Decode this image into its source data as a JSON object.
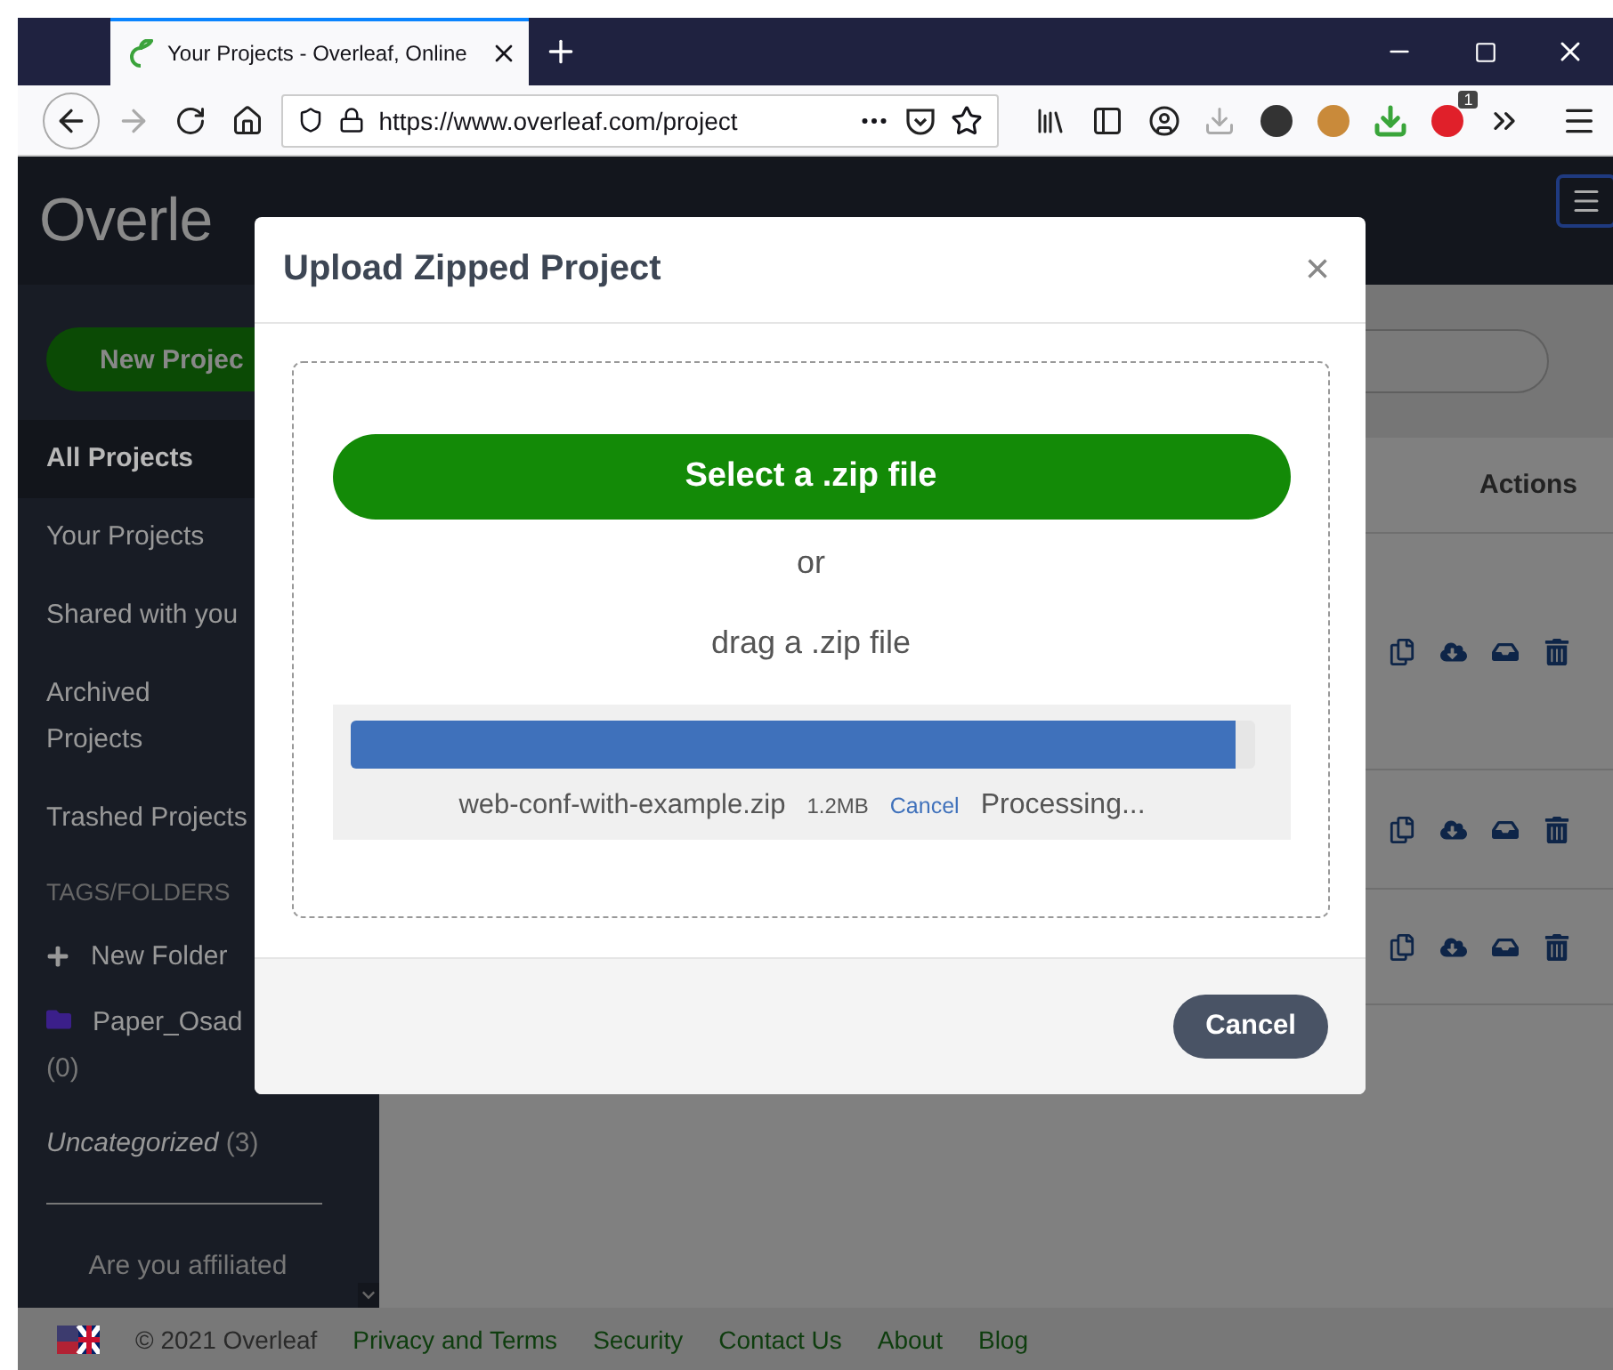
{
  "browser": {
    "tab": {
      "title": "Your Projects - Overleaf, Online",
      "selected": true
    },
    "url": "https://www.overleaf.com/project",
    "extension_badge": "1"
  },
  "header": {
    "logo": "Overle"
  },
  "sidebar": {
    "new_project": "New Projec",
    "items": [
      {
        "label": "All Projects",
        "selected": true
      },
      {
        "label": "Your Projects",
        "selected": false
      },
      {
        "label": "Shared with you",
        "selected": false
      },
      {
        "label": "Archived Projects",
        "selected": false
      },
      {
        "label": "Trashed Projects",
        "selected": false
      }
    ],
    "tags_heading": "TAGS/FOLDERS",
    "new_folder": "New Folder",
    "folders": [
      {
        "name": "Paper_Osad",
        "count": "(0)",
        "color": "#3b1f8a"
      }
    ],
    "uncategorized": {
      "label": "Uncategorized",
      "count": "(3)"
    },
    "affiliation": "Are you affiliated"
  },
  "main": {
    "actions_heading": "Actions",
    "rows": [
      {
        "actions": [
          {
            "kind": "copy"
          },
          {
            "kind": "download"
          },
          {
            "kind": "archive"
          },
          {
            "kind": "trash"
          }
        ]
      },
      {
        "actions": [
          {
            "kind": "copy"
          },
          {
            "kind": "download"
          },
          {
            "kind": "archive"
          },
          {
            "kind": "trash"
          }
        ]
      },
      {
        "actions": [
          {
            "kind": "copy"
          },
          {
            "kind": "download"
          },
          {
            "kind": "archive"
          },
          {
            "kind": "trash"
          }
        ]
      }
    ]
  },
  "modal": {
    "title": "Upload Zipped Project",
    "close": "×",
    "select_button": "Select a .zip file",
    "or": "or",
    "drag": "drag a .zip file",
    "upload": {
      "level": 0.98,
      "filename": "web-conf-with-example.zip",
      "size": "1.2MB",
      "cancel": "Cancel",
      "status": "Processing..."
    },
    "cancel_button": "Cancel"
  },
  "footer": {
    "copyright": "© 2021 Overleaf",
    "links": [
      "Privacy and Terms",
      "Security",
      "Contact Us",
      "About",
      "Blog"
    ]
  }
}
